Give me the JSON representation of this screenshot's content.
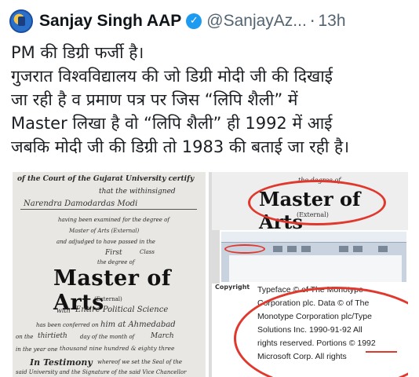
{
  "tweet": {
    "author_name": "Sanjay Singh AAP",
    "verified_mark": "✓",
    "handle": "@SanjayAz...",
    "separator": "·",
    "time": "13h",
    "text_lines": [
      "PM की डिग्री फर्जी है।",
      "गुजरात विश्वविद्यालय की जो डिग्री मोदी जी की दिखाई",
      "जा रही है व प्रमाण पत्र पर जिस “लिपि शैली” में",
      "Master लिखा है वो “लिपि शैली” ही 1992 में आई",
      "जबकि मोदी जी की डिग्री तो 1983 की बताई जा रही है।"
    ]
  },
  "media": {
    "certificate": {
      "header": "of the Court of the Gujarat University certify",
      "withinsigned": "that the withinsigned",
      "name": "Narendra Damodardas Modi",
      "examined": "having been examined for the degree of",
      "degree_small": "Master of Arts (External)",
      "adjudged": "and adjudged to have passed in the",
      "class": "First",
      "class_suffix": "Class",
      "degree_of": "the degree of",
      "degree_big": "Master of Arts",
      "external": "(External)",
      "with": "with",
      "subject": "Entire Political Science",
      "conferred": "has been conferred on",
      "conferred_on": "him at Ahmedabad",
      "on_the": "on the",
      "day": "thirtieth",
      "day_of": "day of the month of",
      "month": "March",
      "year_prefix": "in the year one",
      "year": "thousand nine hundred & eighty three",
      "testimony": "In Testimony",
      "testimony_rest": "whereof we set the Seal of the",
      "signature": "said University and the Signature of the said Vice Chancellor"
    },
    "crop_degree": {
      "degree_of": "the degree of",
      "title": "Master of Arts",
      "external": "(External)"
    },
    "crop_copyright": {
      "label": "Copyright",
      "lines": [
        "Typeface © of The Monotype",
        "Corporation plc. Data © of The",
        "Monotype Corporation plc/Type",
        "Solutions Inc. 1990-91-92 All",
        "rights reserved. Portions © 1992",
        "Microsoft Corp. All rights"
      ]
    }
  },
  "colors": {
    "text": "#0f1419",
    "muted": "#536471",
    "verified": "#1d9bf0",
    "annotation_red": "#e0382c"
  }
}
